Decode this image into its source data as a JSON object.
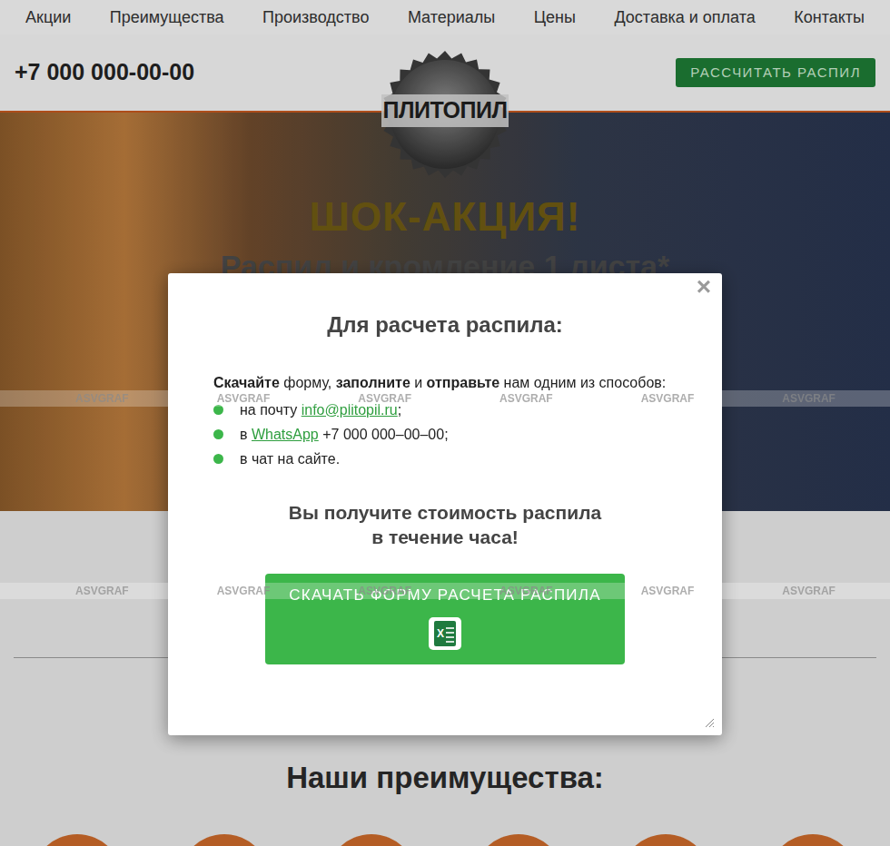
{
  "nav": {
    "items": [
      "Акции",
      "Преимущества",
      "Производство",
      "Материалы",
      "Цены",
      "Доставка и оплата",
      "Контакты"
    ]
  },
  "header": {
    "phone": "+7 000 000-00-00",
    "logo": "ПЛИТОПИЛ",
    "cta": "РАССЧИТАТЬ РАСПИЛ"
  },
  "hero": {
    "title": "ШОК-АКЦИЯ!",
    "subtitle": "Распил и кромление 1 листа*"
  },
  "section": {
    "title": "Наши преимущества:"
  },
  "modal": {
    "close": "×",
    "title": "Для расчета распила:",
    "intro": [
      {
        "text": "Скачайте",
        "bold": true
      },
      {
        "text": " форму, ",
        "bold": false
      },
      {
        "text": "заполните",
        "bold": true
      },
      {
        "text": " и ",
        "bold": false
      },
      {
        "text": "отправьте",
        "bold": true
      },
      {
        "text": " нам одним из способов:",
        "bold": false
      }
    ],
    "methods": [
      [
        {
          "text": "на почту ",
          "kind": "plain"
        },
        {
          "text": "info@plitopil.ru",
          "kind": "link"
        },
        {
          "text": ";",
          "kind": "plain"
        }
      ],
      [
        {
          "text": "в ",
          "kind": "plain"
        },
        {
          "text": "WhatsApp",
          "kind": "link"
        },
        {
          "text": " +7 000 000–00–00;",
          "kind": "plain"
        }
      ],
      [
        {
          "text": "в чат на сайте.",
          "kind": "plain"
        }
      ]
    ],
    "result": [
      "Вы получите стоимость распила",
      "в течение часа!"
    ],
    "button": "СКАЧАТЬ ФОРМУ РАСЧЕТА РАСПИЛА",
    "excel_icon_letter": "X"
  },
  "watermarks": [
    [
      "ASVGRAF",
      "ASVGRAF",
      "ASVGRAF",
      "ASVGRAF",
      "ASVGRAF",
      "ASVGRAF"
    ],
    [
      "ASVGRAF",
      "ASVGRAF",
      "ASVGRAF",
      "ASVGRAF",
      "ASVGRAF",
      "ASVGRAF"
    ]
  ]
}
